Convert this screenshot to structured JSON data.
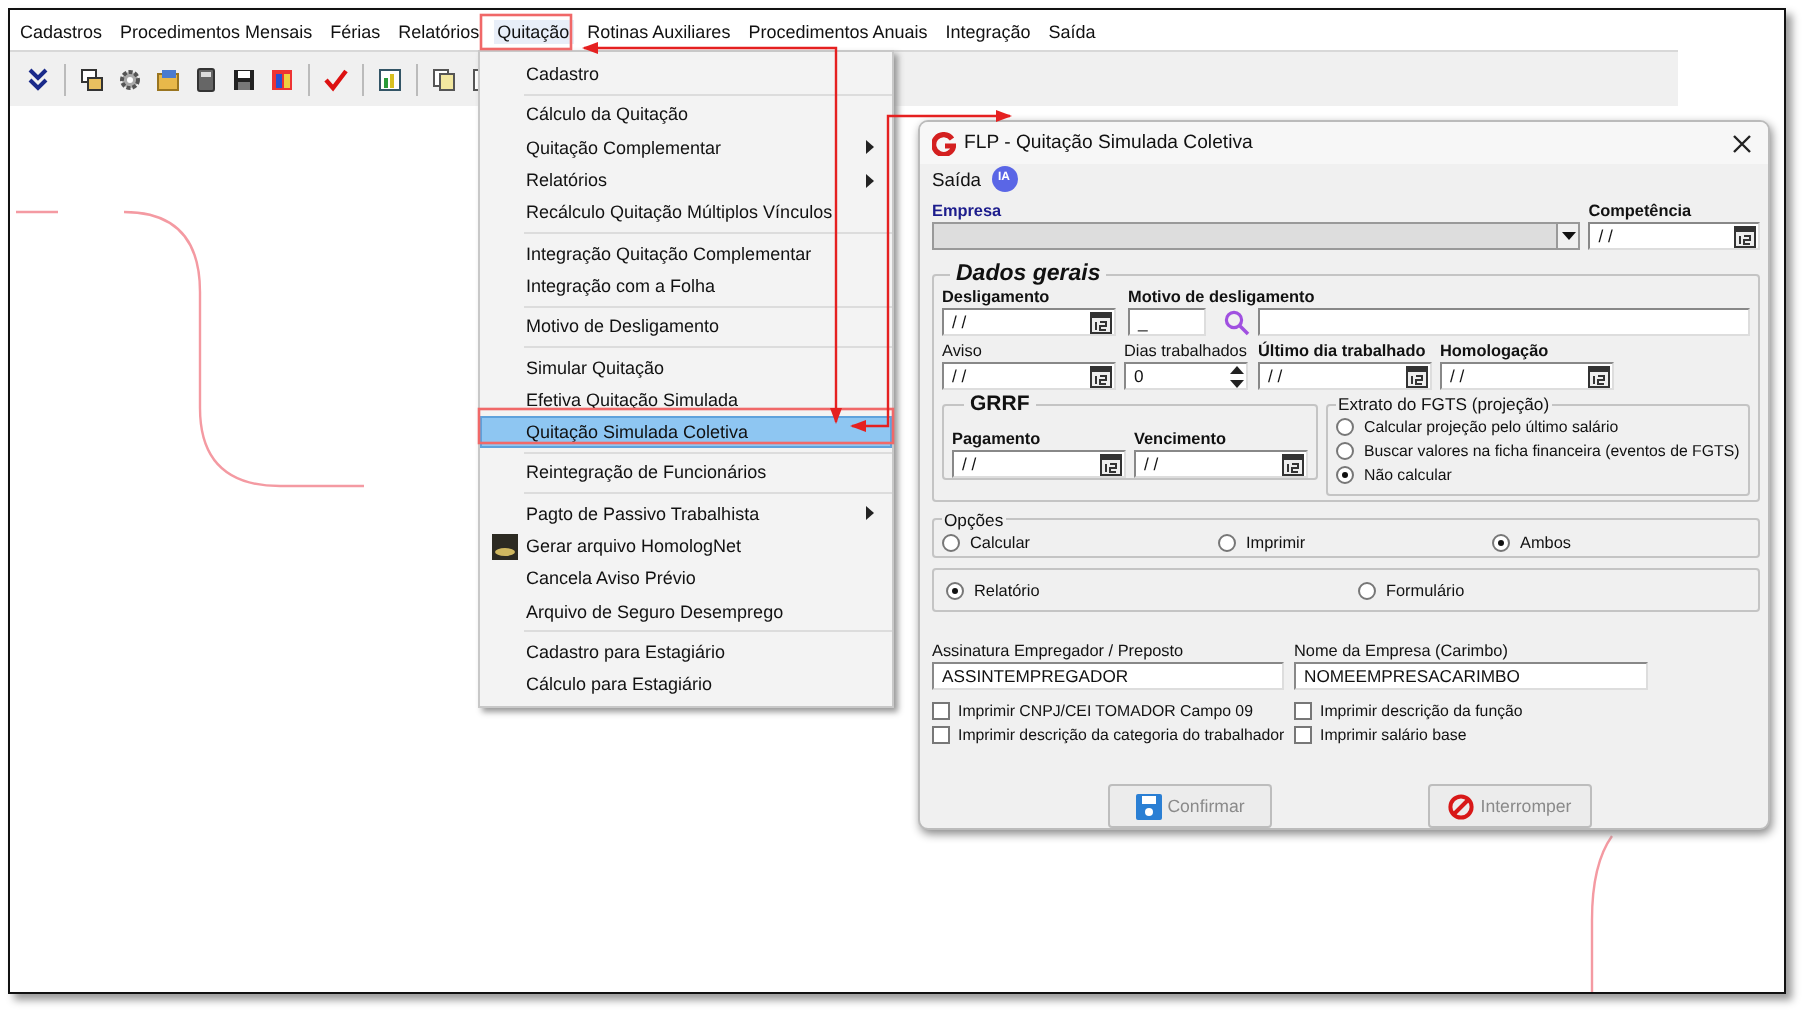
{
  "menubar": [
    {
      "label": "Cadastros",
      "selected": false
    },
    {
      "label": "Procedimentos Mensais",
      "selected": false
    },
    {
      "label": "Férias",
      "selected": false
    },
    {
      "label": "Relatórios",
      "selected": false
    },
    {
      "label": "Quitação",
      "selected": true
    },
    {
      "label": "Rotinas Auxiliares",
      "selected": false
    },
    {
      "label": "Procedimentos Anuais",
      "selected": false
    },
    {
      "label": "Integração",
      "selected": false
    },
    {
      "label": "Saída",
      "selected": false
    }
  ],
  "dropdown": {
    "groups": [
      [
        {
          "label": "Cadastro",
          "selected": false,
          "submenu": false,
          "icon": false
        }
      ],
      [
        {
          "label": "Cálculo da Quitação",
          "selected": false,
          "submenu": false,
          "icon": false
        },
        {
          "label": "Quitação Complementar",
          "selected": false,
          "submenu": true,
          "icon": false
        },
        {
          "label": "Relatórios",
          "selected": false,
          "submenu": true,
          "icon": false
        },
        {
          "label": "Recálculo Quitação Múltiplos Vínculos",
          "selected": false,
          "submenu": false,
          "icon": false
        }
      ],
      [
        {
          "label": "Integração Quitação Complementar",
          "selected": false,
          "submenu": false,
          "icon": false
        },
        {
          "label": "Integração com a Folha",
          "selected": false,
          "submenu": false,
          "icon": false
        }
      ],
      [
        {
          "label": "Motivo de Desligamento",
          "selected": false,
          "submenu": false,
          "icon": false
        }
      ],
      [
        {
          "label": "Simular Quitação",
          "selected": false,
          "submenu": false,
          "icon": false
        },
        {
          "label": "Efetiva Quitação Simulada",
          "selected": false,
          "submenu": false,
          "icon": false
        },
        {
          "label": "Quitação Simulada Coletiva",
          "selected": true,
          "submenu": false,
          "icon": false
        }
      ],
      [
        {
          "label": "Reintegração de Funcionários",
          "selected": false,
          "submenu": false,
          "icon": false
        }
      ],
      [
        {
          "label": "Pagto de Passivo Trabalhista",
          "selected": false,
          "submenu": true,
          "icon": false
        },
        {
          "label": "Gerar arquivo HomologNet",
          "selected": false,
          "submenu": false,
          "icon": true
        },
        {
          "label": "Cancela Aviso Prévio",
          "selected": false,
          "submenu": false,
          "icon": false
        },
        {
          "label": "Arquivo de Seguro Desemprego",
          "selected": false,
          "submenu": false,
          "icon": false
        }
      ],
      [
        {
          "label": "Cadastro para Estagiário",
          "selected": false,
          "submenu": false,
          "icon": false
        },
        {
          "label": "Cálculo para Estagiário",
          "selected": false,
          "submenu": false,
          "icon": false
        }
      ]
    ]
  },
  "dialog": {
    "title": "FLP - Quitação Simulada Coletiva",
    "menu": [
      "Saída"
    ],
    "badge": "IA",
    "empresa": {
      "label": "Empresa"
    },
    "competencia": {
      "label": "Competência",
      "value": "/ /"
    },
    "dados_gerais": {
      "legend": "Dados gerais",
      "row_1": [
        {
          "label": "Desligamento",
          "required": true,
          "kind": "date",
          "value": "/ /"
        },
        {
          "label": "Motivo de desligamento",
          "required": true,
          "kind": "lookup",
          "value": "_"
        }
      ],
      "row_2": [
        {
          "label": "Aviso",
          "required": false,
          "kind": "date",
          "value": "/ /"
        },
        {
          "label": "Dias trabalhados",
          "required": false,
          "kind": "spin",
          "value": "0"
        },
        {
          "label": "Último dia trabalhado",
          "required": true,
          "kind": "date",
          "value": "/ /"
        },
        {
          "label": "Homologação",
          "required": true,
          "kind": "date",
          "value": "/ /"
        }
      ],
      "grrf": {
        "legend": "GRRF",
        "fields": [
          {
            "label": "Pagamento",
            "required": true,
            "kind": "date",
            "value": "/ /"
          },
          {
            "label": "Vencimento",
            "required": true,
            "kind": "date",
            "value": "/ /"
          }
        ]
      },
      "extrato": {
        "legend": "Extrato do FGTS (projeção)",
        "options": [
          {
            "label": "Calcular projeção pelo último salário",
            "selected": false
          },
          {
            "label": "Buscar valores na ficha financeira (eventos de FGTS)",
            "selected": false
          },
          {
            "label": "Não calcular",
            "selected": true
          }
        ]
      }
    },
    "opcoes": {
      "legend": "Opções",
      "options": [
        {
          "label": "Calcular",
          "selected": false
        },
        {
          "label": "Imprimir",
          "selected": false
        },
        {
          "label": "Ambos",
          "selected": true
        }
      ]
    },
    "tipo": {
      "options": [
        {
          "label": "Relatório",
          "selected": true
        },
        {
          "label": "Formulário",
          "selected": false
        }
      ]
    },
    "text_fields": [
      {
        "label": "Assinatura Empregador / Preposto",
        "value": "ASSINTEMPREGADOR"
      },
      {
        "label": "Nome da Empresa (Carimbo)",
        "value": "NOMEEMPRESACARIMBO"
      }
    ],
    "checkboxes": [
      [
        {
          "label": "Imprimir CNPJ/CEI TOMADOR Campo 09",
          "checked": false
        },
        {
          "label": "Imprimir descrição da categoria do trabalhador",
          "checked": false
        }
      ],
      [
        {
          "label": "Imprimir descrição da função",
          "checked": false
        },
        {
          "label": "Imprimir salário base",
          "checked": false
        }
      ]
    ],
    "buttons": [
      {
        "label": "Confirmar",
        "kind": "save",
        "disabled": true
      },
      {
        "label": "Interromper",
        "kind": "stop",
        "disabled": true
      }
    ]
  }
}
